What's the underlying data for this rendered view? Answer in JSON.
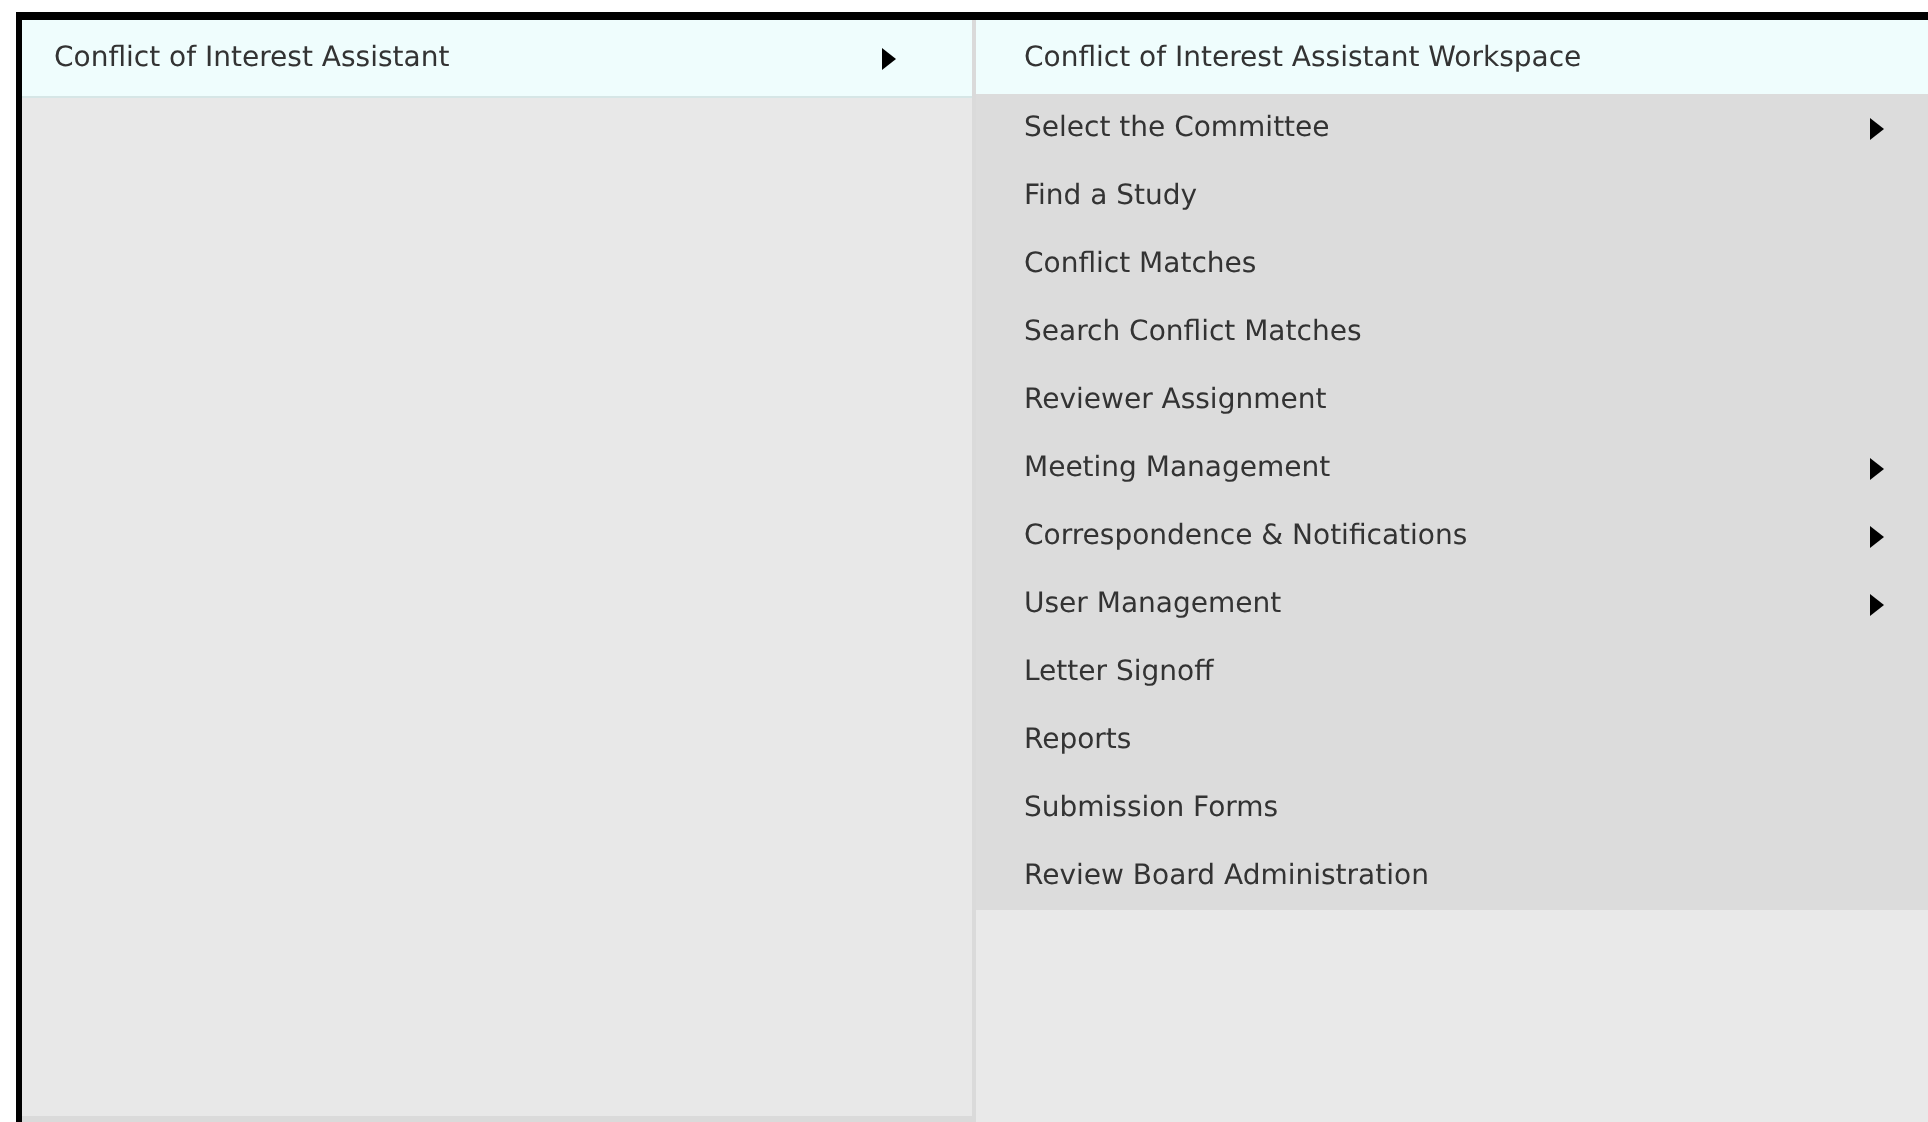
{
  "menu": {
    "label": "Conflict of Interest Assistant",
    "selected": true,
    "has_submenu": true
  },
  "submenu": [
    {
      "label": "Conflict of Interest Assistant Workspace",
      "selected": true,
      "has_submenu": false
    },
    {
      "label": "Select the Committee",
      "selected": false,
      "has_submenu": true
    },
    {
      "label": "Find a Study",
      "selected": false,
      "has_submenu": false
    },
    {
      "label": "Conflict Matches",
      "selected": false,
      "has_submenu": false
    },
    {
      "label": "Search Conflict Matches",
      "selected": false,
      "has_submenu": false
    },
    {
      "label": "Reviewer Assignment",
      "selected": false,
      "has_submenu": false
    },
    {
      "label": "Meeting Management",
      "selected": false,
      "has_submenu": true
    },
    {
      "label": "Correspondence & Notifications",
      "selected": false,
      "has_submenu": true
    },
    {
      "label": "User Management",
      "selected": false,
      "has_submenu": true
    },
    {
      "label": "Letter Signoff",
      "selected": false,
      "has_submenu": false
    },
    {
      "label": "Reports",
      "selected": false,
      "has_submenu": false
    },
    {
      "label": "Submission Forms",
      "selected": false,
      "has_submenu": false
    },
    {
      "label": "Review Board Administration",
      "selected": false,
      "has_submenu": false
    }
  ]
}
